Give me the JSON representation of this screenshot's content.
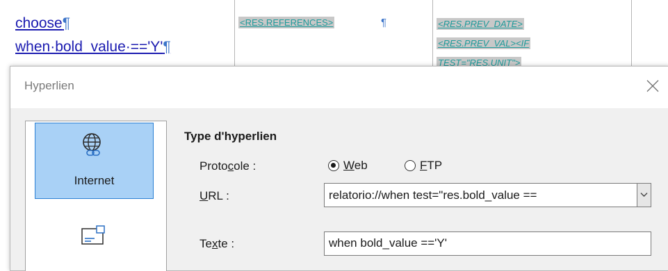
{
  "document": {
    "line1": "choose",
    "line2": "when·bold_value·=='Y'",
    "pilcrow": "¶",
    "field_references": "<RES.REFERENCES>",
    "field_prev_date": "<RES.PREV_DATE>",
    "field_prev_val": "<RES.PREV_VAL><IF",
    "field_test": "TEST=\"RES.UNIT\">"
  },
  "dialog": {
    "title": "Hyperlien",
    "categories": [
      {
        "label": "Internet",
        "icon": "globe-link-icon",
        "selected": true
      },
      {
        "label": "",
        "icon": "mail-icon",
        "selected": false
      }
    ],
    "section_title": "Type d'hyperlien",
    "protocol": {
      "label_pre": "Proto",
      "label_u": "c",
      "label_post": "ole :",
      "options": [
        {
          "u": "W",
          "rest": "eb",
          "selected": true
        },
        {
          "u": "F",
          "rest": "TP",
          "selected": false
        }
      ]
    },
    "url": {
      "label_u": "U",
      "label_post": "RL :",
      "value": "relatorio://when test=\"res.bold_value =="
    },
    "text": {
      "label_pre": "Te",
      "label_u": "x",
      "label_post": "te :",
      "value": "when bold_value =='Y'"
    }
  }
}
